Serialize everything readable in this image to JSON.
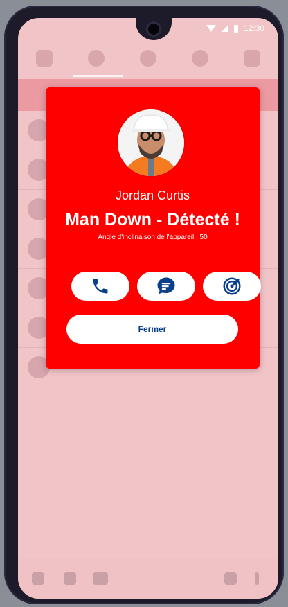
{
  "status": {
    "time": "12:30"
  },
  "modal": {
    "name": "Jordan Curtis",
    "title": "Man Down - Détecté !",
    "subtitle": "Angle d'inclinaison de l'appareil : 50",
    "close_label": "Fermer"
  },
  "colors": {
    "alert_red": "#ff0000",
    "overlay_pink": "#f1c4c8",
    "action_blue": "#0a3f8c"
  },
  "icons": {
    "call": "phone-icon",
    "message": "chat-icon",
    "locate": "radar-icon"
  }
}
